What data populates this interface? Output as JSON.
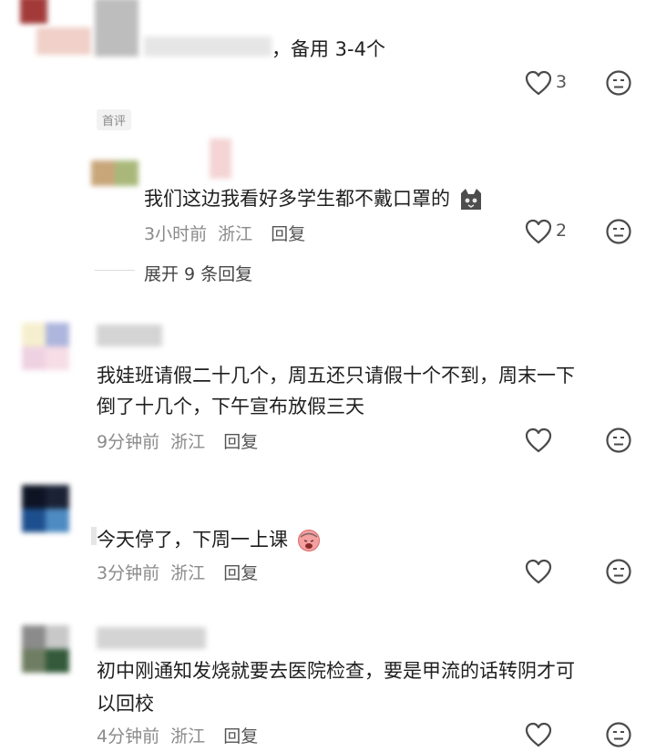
{
  "comments": [
    {
      "text": "备用 3-4个",
      "prefix": "，",
      "likes": "3",
      "badge": "首评"
    },
    {
      "text": "我们这边我看好多学生都不戴口罩的",
      "time": "3小时前",
      "location": "浙江",
      "reply": "回复",
      "likes": "2",
      "expand": "展开 9 条回复"
    },
    {
      "text_line1": "我娃班请假二十几个，周五还只请假十个不到，周末一下",
      "text_line2": "倒了十几个，下午宣布放假三天",
      "time": "9分钟前",
      "location": "浙江",
      "reply": "回复"
    },
    {
      "text": "今天停了，下周一上课",
      "time": "3分钟前",
      "location": "浙江",
      "reply": "回复"
    },
    {
      "text_line1": "初中刚通知发烧就要去医院检查，要是甲流的话转阴才可",
      "text_line2": "以回校",
      "time": "4分钟前",
      "location": "浙江",
      "reply": "回复"
    }
  ],
  "icons": {
    "like": "heart-icon",
    "dislike": "dislike-face-icon",
    "emoji_cat": "cat-face-emoji",
    "emoji_cry": "crying-face-emoji"
  },
  "colors": {
    "text": "#1f1f1f",
    "meta": "#8a8a8a",
    "icon": "#4a4a4a"
  }
}
